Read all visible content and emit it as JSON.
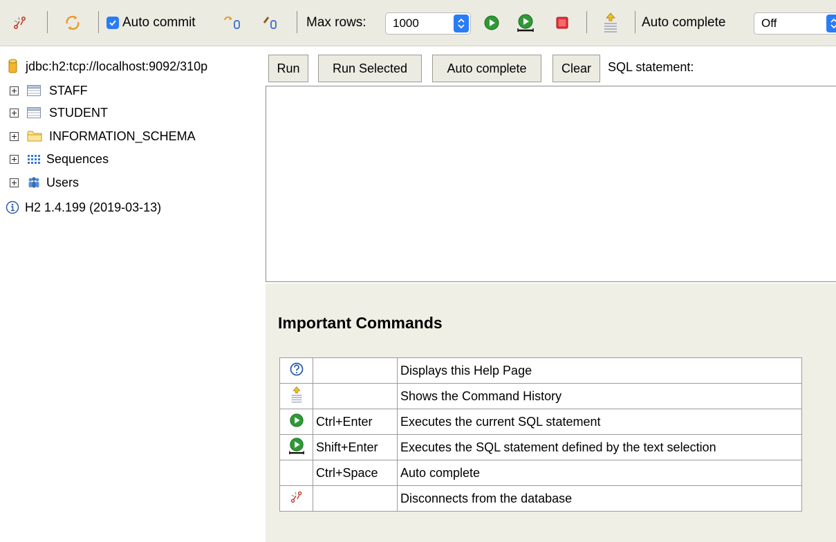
{
  "toolbar": {
    "auto_commit_label": "Auto commit",
    "max_rows_label": "Max rows:",
    "max_rows_value": "1000",
    "auto_complete_label": "Auto complete",
    "auto_complete_value": "Off",
    "accent_color": "#2a7cf6"
  },
  "buttons": {
    "run": "Run",
    "run_selected": "Run Selected",
    "auto_complete": "Auto complete",
    "clear": "Clear",
    "sql_statement_label": "SQL statement:"
  },
  "tree": {
    "connection": "jdbc:h2:tcp://localhost:9092/310p",
    "items": [
      {
        "label": "STAFF",
        "icon": "table-icon"
      },
      {
        "label": "STUDENT",
        "icon": "table-icon"
      },
      {
        "label": "INFORMATION_SCHEMA",
        "icon": "folder-icon"
      },
      {
        "label": "Sequences",
        "icon": "sequences-icon"
      },
      {
        "label": "Users",
        "icon": "users-icon"
      }
    ],
    "version": "H2 1.4.199 (2019-03-13)"
  },
  "help": {
    "title": "Important Commands",
    "rows": [
      {
        "icon": "help-icon",
        "shortcut": "",
        "description": "Displays this Help Page"
      },
      {
        "icon": "history-icon",
        "shortcut": "",
        "description": "Shows the Command History"
      },
      {
        "icon": "run-icon",
        "shortcut": "Ctrl+Enter",
        "description": "Executes the current SQL statement"
      },
      {
        "icon": "run-selected-icon",
        "shortcut": "Shift+Enter",
        "description": "Executes the SQL statement defined by the text selection"
      },
      {
        "icon": "",
        "shortcut": "Ctrl+Space",
        "description": "Auto complete"
      },
      {
        "icon": "disconnect-icon",
        "shortcut": "",
        "description": "Disconnects from the database"
      }
    ]
  }
}
